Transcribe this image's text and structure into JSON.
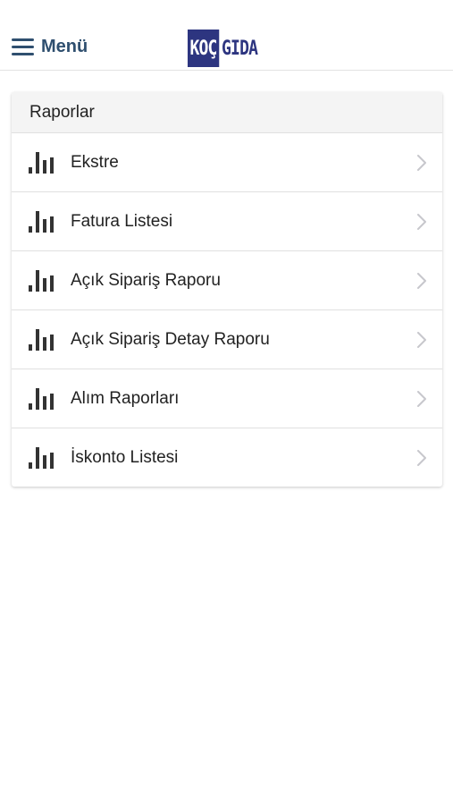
{
  "header": {
    "menu_label": "Menü",
    "logo_left": "KOÇ",
    "logo_right": "GIDA"
  },
  "reports": {
    "title": "Raporlar",
    "items": [
      {
        "label": "Ekstre",
        "icon": "bar-chart-icon"
      },
      {
        "label": "Fatura Listesi",
        "icon": "bar-chart-icon"
      },
      {
        "label": "Açık Sipariş Raporu",
        "icon": "bar-chart-icon"
      },
      {
        "label": "Açık Sipariş Detay Raporu",
        "icon": "bar-chart-icon"
      },
      {
        "label": "Alım Raporları",
        "icon": "bar-chart-icon"
      },
      {
        "label": "İskonto Listesi",
        "icon": "bar-chart-icon"
      }
    ]
  },
  "colors": {
    "brand": "#2d3580",
    "menu": "#2f4f6f",
    "icon": "#333333",
    "chevron": "#c7c7cc"
  }
}
